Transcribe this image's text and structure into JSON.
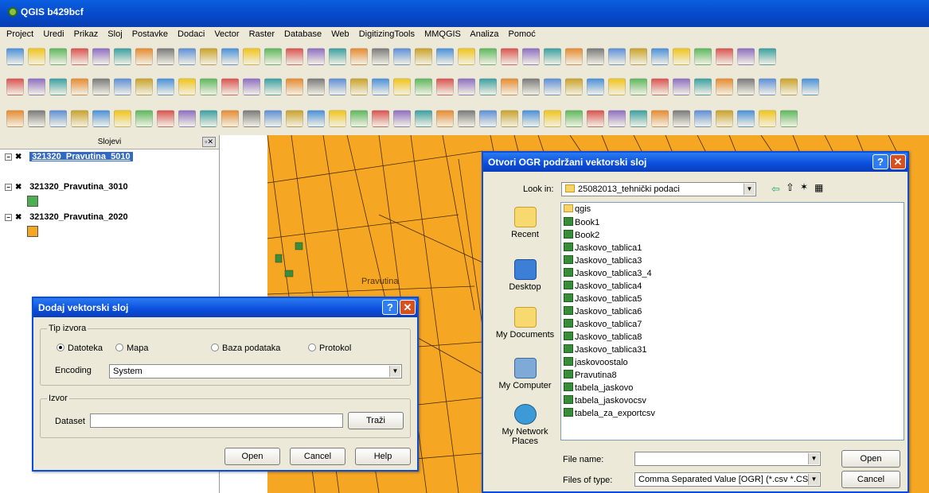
{
  "window": {
    "title": "QGIS b429bcf"
  },
  "menu": [
    "Project",
    "Uredi",
    "Prikaz",
    "Sloj",
    "Postavke",
    "Dodaci",
    "Vector",
    "Raster",
    "Database",
    "Web",
    "DigitizingTools",
    "MMQGIS",
    "Analiza",
    "Pomoć"
  ],
  "layers_panel": {
    "title": "Slojevi",
    "items": [
      {
        "name": "321320_Pravutina_5010",
        "color": ""
      },
      {
        "name": "321320_Pravutina_3010",
        "color": "#4caf50"
      },
      {
        "name": "321320_Pravutina_2020",
        "color": "#f5a623"
      }
    ]
  },
  "map": {
    "label": "Pravutina"
  },
  "add_dialog": {
    "title": "Dodaj vektorski sloj",
    "source_type_label": "Tip izvora",
    "radios": [
      "Datoteka",
      "Mapa",
      "Baza podataka",
      "Protokol"
    ],
    "encoding_label": "Encoding",
    "encoding_value": "System",
    "source_label": "Izvor",
    "dataset_label": "Dataset",
    "dataset_value": "",
    "browse": "Traži",
    "open": "Open",
    "cancel": "Cancel",
    "help": "Help"
  },
  "ogr_dialog": {
    "title": "Otvori OGR podržani vektorski sloj",
    "lookin_label": "Look in:",
    "lookin_value": "25082013_tehnički podaci",
    "places": [
      "Recent",
      "Desktop",
      "My Documents",
      "My Computer",
      "My Network Places"
    ],
    "files": [
      "qgis",
      "Book1",
      "Book2",
      "Jaskovo_tablica1",
      "Jaskovo_tablica3",
      "Jaskovo_tablica3_4",
      "Jaskovo_tablica4",
      "Jaskovo_tablica5",
      "Jaskovo_tablica6",
      "Jaskovo_tablica7",
      "Jaskovo_tablica8",
      "Jaskovo_tablica31",
      "jaskovoostalo",
      "Pravutina8",
      "tabela_jaskovo",
      "tabela_jaskovocsv",
      "tabela_za_exportcsv"
    ],
    "filename_label": "File name:",
    "filename_value": "",
    "filetype_label": "Files of type:",
    "filetype_value": "Comma Separated Value [OGR] (*.csv *.CSV)",
    "open": "Open",
    "cancel": "Cancel"
  }
}
